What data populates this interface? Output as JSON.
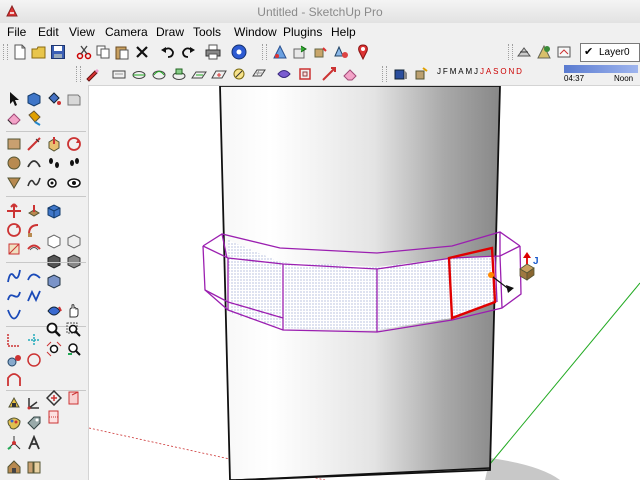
{
  "window": {
    "title": "Untitled - SketchUp Pro"
  },
  "menu": {
    "items": [
      "File",
      "Edit",
      "View",
      "Camera",
      "Draw",
      "Tools",
      "Window",
      "Plugins",
      "Help"
    ]
  },
  "layers": {
    "current": "Layer0"
  },
  "shadows": {
    "months": [
      "J",
      "F",
      "M",
      "A",
      "M",
      "J",
      "J",
      "A",
      "S",
      "O",
      "N",
      "D"
    ],
    "time": "04:37",
    "noon": "Noon"
  },
  "axis": {
    "blue_label": "J"
  },
  "colors": {
    "selection": "#9b1fb0",
    "highlight": "#e00000",
    "red_axis": "#cc3333",
    "green_axis": "#22aa22",
    "blue_axis": "#1a5acc"
  }
}
